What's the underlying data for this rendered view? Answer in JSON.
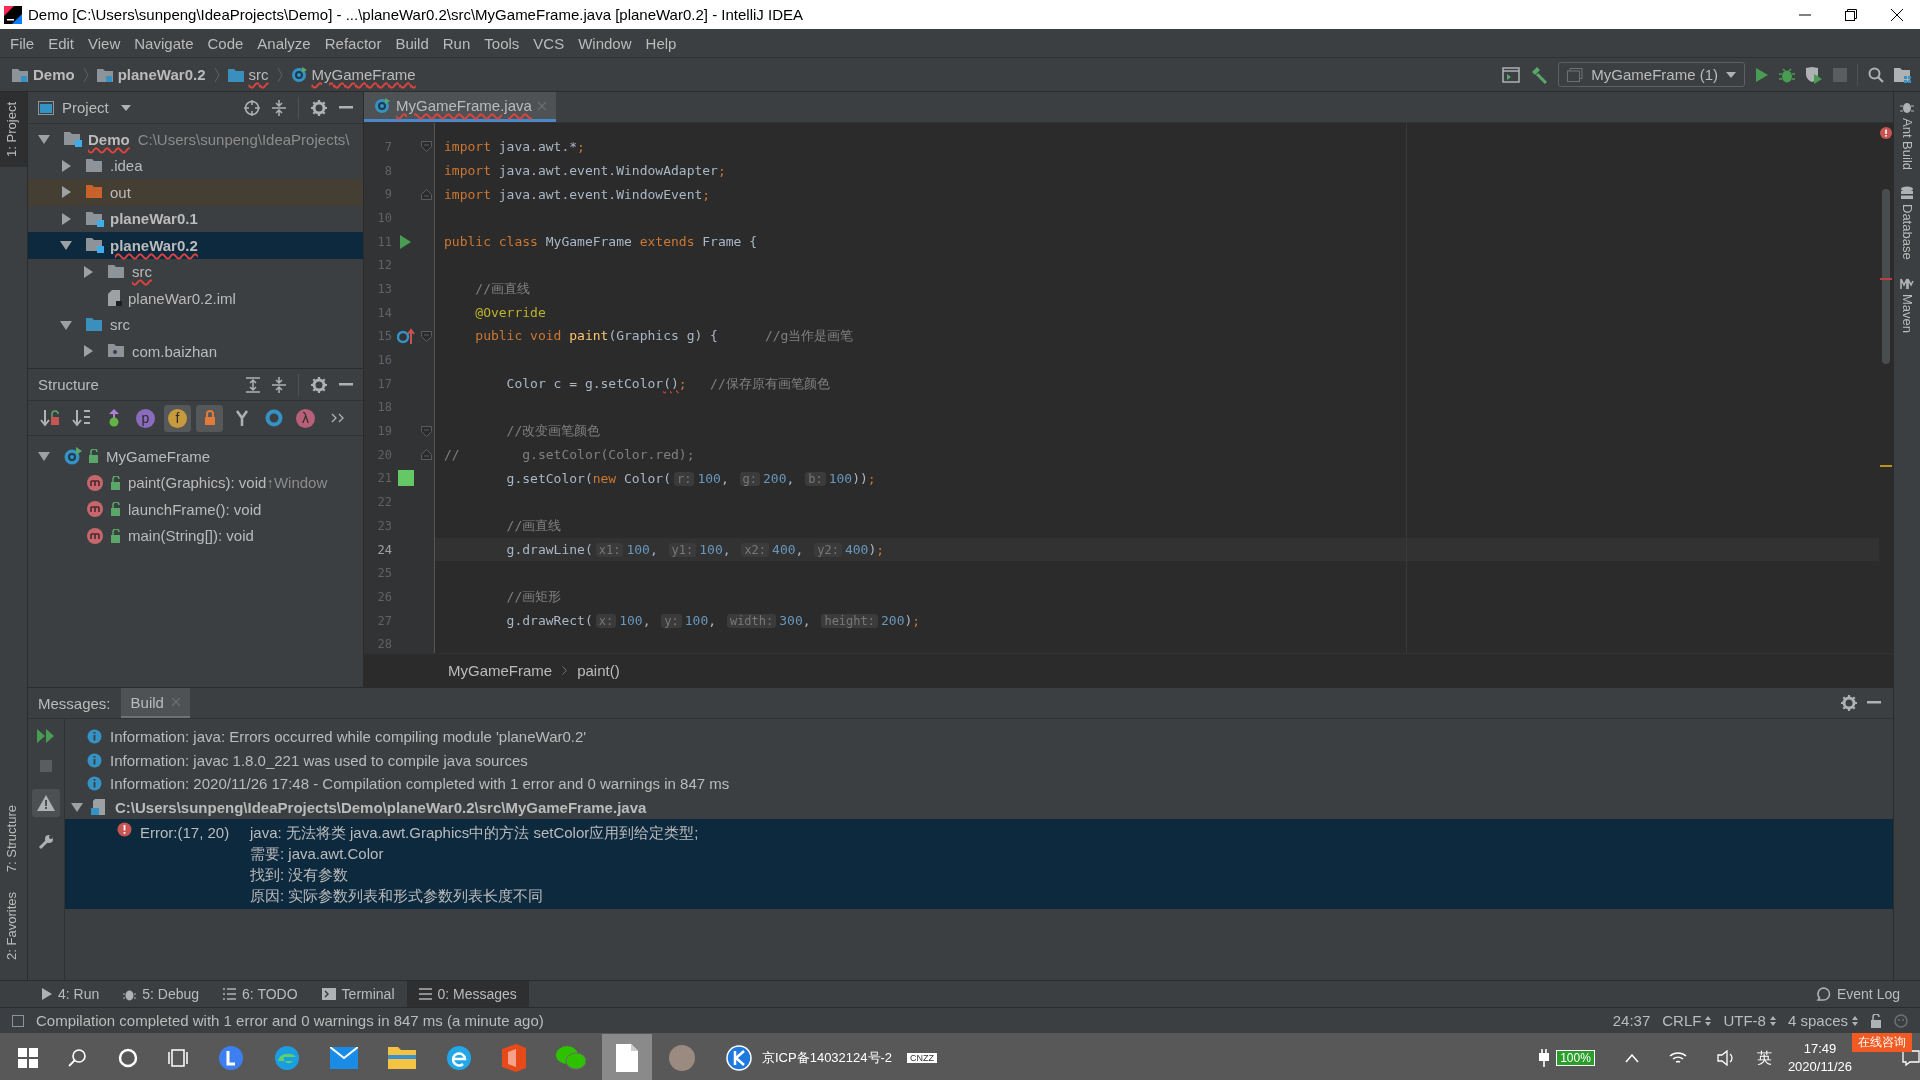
{
  "window": {
    "title": "Demo [C:\\Users\\sunpeng\\IdeaProjects\\Demo] - ...\\planeWar0.2\\src\\MyGameFrame.java [planeWar0.2] - IntelliJ IDEA"
  },
  "menu": [
    "File",
    "Edit",
    "View",
    "Navigate",
    "Code",
    "Analyze",
    "Refactor",
    "Build",
    "Run",
    "Tools",
    "VCS",
    "Window",
    "Help"
  ],
  "breadcrumb": [
    {
      "label": "Demo",
      "kind": "module",
      "error": false
    },
    {
      "label": "planeWar0.2",
      "kind": "module",
      "error": false
    },
    {
      "label": "src",
      "kind": "folder",
      "error": true
    },
    {
      "label": "MyGameFrame",
      "kind": "class",
      "error": true
    }
  ],
  "run_config": {
    "label": "MyGameFrame (1)"
  },
  "left_stripe": [
    {
      "label": "1: Project",
      "selected": true
    },
    {
      "label": "7: Structure",
      "selected": false
    },
    {
      "label": "2: Favorites",
      "selected": false
    }
  ],
  "right_stripe": [
    "Ant Build",
    "Database",
    "Maven"
  ],
  "project": {
    "title": "Project",
    "tree": [
      {
        "label": "Demo",
        "path": "C:\\Users\\sunpeng\\IdeaProjects\\",
        "kind": "module",
        "bold": true,
        "error": true,
        "expanded": true,
        "selected": false,
        "children": [
          {
            "label": ".idea",
            "kind": "folder",
            "bold": false,
            "error": false,
            "expanded": false,
            "selected": false
          },
          {
            "label": "out",
            "kind": "excluded",
            "bold": false,
            "error": false,
            "expanded": false,
            "selected": false
          },
          {
            "label": "planeWar0.1",
            "kind": "module",
            "bold": true,
            "error": false,
            "expanded": false,
            "selected": false
          },
          {
            "label": "planeWar0.2",
            "kind": "module",
            "bold": true,
            "error": true,
            "expanded": true,
            "selected": true,
            "children": [
              {
                "label": "src",
                "kind": "folder",
                "bold": false,
                "error": true,
                "expanded": false,
                "selected": false
              },
              {
                "label": "planeWar0.2.iml",
                "kind": "file",
                "bold": false,
                "error": false,
                "selected": false
              }
            ]
          },
          {
            "label": "src",
            "kind": "source",
            "bold": false,
            "error": false,
            "expanded": true,
            "selected": false,
            "children": [
              {
                "label": "com.baizhan",
                "kind": "package",
                "bold": false,
                "error": false,
                "expanded": false,
                "selected": false
              }
            ]
          }
        ]
      }
    ]
  },
  "structure": {
    "title": "Structure",
    "toolbar": [
      {
        "kind": "sort-visibility",
        "on": false
      },
      {
        "kind": "sort-alpha",
        "on": false
      },
      {
        "kind": "inherited",
        "on": false
      },
      {
        "kind": "badge",
        "glyph": "p",
        "color": "#8b6bbd",
        "on": false
      },
      {
        "kind": "badge",
        "glyph": "f",
        "color": "#c79a3c",
        "on": true
      },
      {
        "kind": "lock",
        "on": true
      },
      {
        "kind": "branch",
        "on": false
      },
      {
        "kind": "ring",
        "on": false
      },
      {
        "kind": "badge",
        "glyph": "λ",
        "color": "#b8607a",
        "on": false
      },
      {
        "kind": "more",
        "on": false
      }
    ],
    "tree": [
      {
        "label": "MyGameFrame",
        "kind": "class",
        "expanded": true,
        "selected": false,
        "children": [
          {
            "label": "paint(Graphics): void",
            "inherited": "↑Window",
            "kind": "method",
            "selected": false
          },
          {
            "label": "launchFrame(): void",
            "kind": "method",
            "selected": false
          },
          {
            "label": "main(String[]): void",
            "kind": "method",
            "selected": false
          }
        ]
      }
    ]
  },
  "editor": {
    "tabs": [
      {
        "label": "MyGameFrame.java",
        "selected": true,
        "error": true
      }
    ],
    "lines": [
      {
        "number": "7",
        "current": false,
        "fold": {
          "kind": "start"
        },
        "tokens": [
          {
            "kind": "kw",
            "text": "import"
          },
          {
            "kind": "plain",
            "text": " java.awt.*"
          },
          {
            "kind": "kw",
            "text": ";"
          }
        ]
      },
      {
        "number": "8",
        "current": false,
        "tokens": [
          {
            "kind": "kw",
            "text": "import"
          },
          {
            "kind": "plain",
            "text": " java.awt.event.WindowAdapter"
          },
          {
            "kind": "kw",
            "text": ";"
          }
        ]
      },
      {
        "number": "9",
        "current": false,
        "fold": {
          "kind": "end"
        },
        "tokens": [
          {
            "kind": "kw",
            "text": "import"
          },
          {
            "kind": "plain",
            "text": " java.awt.event.WindowEvent"
          },
          {
            "kind": "kw",
            "text": ";"
          }
        ]
      },
      {
        "number": "10",
        "current": false
      },
      {
        "number": "11",
        "current": false,
        "marker": {
          "kind": "run"
        },
        "tokens": [
          {
            "kind": "kw",
            "text": "public class "
          },
          {
            "kind": "plain",
            "text": "MyGameFrame "
          },
          {
            "kind": "kw",
            "text": "extends "
          },
          {
            "kind": "plain",
            "text": "Frame {"
          }
        ]
      },
      {
        "number": "12",
        "current": false
      },
      {
        "number": "13",
        "current": false,
        "tokens": [
          {
            "kind": "comment",
            "text": "    //画直线"
          }
        ]
      },
      {
        "number": "14",
        "current": false,
        "tokens": [
          {
            "kind": "ann",
            "text": "    @Override"
          }
        ]
      },
      {
        "number": "15",
        "current": false,
        "marker": {
          "kind": "override"
        },
        "fold": {
          "kind": "start"
        },
        "tokens": [
          {
            "kind": "kw",
            "text": "    public void "
          },
          {
            "kind": "fn",
            "text": "paint"
          },
          {
            "kind": "plain",
            "text": "(Graphics g) {      "
          },
          {
            "kind": "comment",
            "text": "//g当作是画笔"
          }
        ]
      },
      {
        "number": "16",
        "current": false
      },
      {
        "number": "17",
        "current": false,
        "tokens": [
          {
            "kind": "plain",
            "text": "        Color c = g.setColor"
          },
          {
            "kind": "err",
            "text": "()"
          },
          {
            "kind": "kw",
            "text": ";"
          },
          {
            "kind": "comment",
            "text": "   //保存原有画笔颜色"
          }
        ]
      },
      {
        "number": "18",
        "current": false
      },
      {
        "number": "19",
        "current": false,
        "fold": {
          "kind": "start"
        },
        "tokens": [
          {
            "kind": "comment",
            "text": "        //改变画笔颜色"
          }
        ]
      },
      {
        "number": "20",
        "current": false,
        "fold": {
          "kind": "end"
        },
        "tokens": [
          {
            "kind": "comment",
            "text": "//        g.setColor(Color.red);"
          }
        ]
      },
      {
        "number": "21",
        "current": false,
        "marker": {
          "kind": "swatch",
          "color": "#64c864"
        },
        "tokens": [
          {
            "kind": "plain",
            "text": "        g.setColor("
          },
          {
            "kind": "kw",
            "text": "new "
          },
          {
            "kind": "plain",
            "text": "Color("
          },
          {
            "kind": "hint",
            "text": "r:"
          },
          {
            "kind": "num",
            "text": "100"
          },
          {
            "kind": "plain",
            "text": ", "
          },
          {
            "kind": "hint",
            "text": "g:"
          },
          {
            "kind": "num",
            "text": "200"
          },
          {
            "kind": "plain",
            "text": ", "
          },
          {
            "kind": "hint",
            "text": "b:"
          },
          {
            "kind": "num",
            "text": "100"
          },
          {
            "kind": "plain",
            "text": "))"
          },
          {
            "kind": "kw",
            "text": ";"
          }
        ]
      },
      {
        "number": "22",
        "current": false
      },
      {
        "number": "23",
        "current": false,
        "tokens": [
          {
            "kind": "comment",
            "text": "        //画直线"
          }
        ]
      },
      {
        "number": "24",
        "current": true,
        "tokens": [
          {
            "kind": "plain",
            "text": "        g.drawLine("
          },
          {
            "kind": "hint",
            "text": "x1:"
          },
          {
            "kind": "num",
            "text": "100"
          },
          {
            "kind": "plain",
            "text": ", "
          },
          {
            "kind": "hint",
            "text": "y1:"
          },
          {
            "kind": "num",
            "text": "100"
          },
          {
            "kind": "plain",
            "text": ", "
          },
          {
            "kind": "hint",
            "text": "x2:"
          },
          {
            "kind": "num",
            "text": "400"
          },
          {
            "kind": "plain",
            "text": ", "
          },
          {
            "kind": "hint",
            "text": "y2:"
          },
          {
            "kind": "num",
            "text": "400"
          },
          {
            "kind": "plain",
            "text": ")"
          },
          {
            "kind": "kw",
            "text": ";"
          }
        ]
      },
      {
        "number": "25",
        "current": false
      },
      {
        "number": "26",
        "current": false,
        "tokens": [
          {
            "kind": "comment",
            "text": "        //画矩形"
          }
        ]
      },
      {
        "number": "27",
        "current": false,
        "tokens": [
          {
            "kind": "plain",
            "text": "        g.drawRect("
          },
          {
            "kind": "hint",
            "text": "x:"
          },
          {
            "kind": "num",
            "text": "100"
          },
          {
            "kind": "plain",
            "text": ", "
          },
          {
            "kind": "hint",
            "text": "y:"
          },
          {
            "kind": "num",
            "text": "100"
          },
          {
            "kind": "plain",
            "text": ", "
          },
          {
            "kind": "hint",
            "text": "width:"
          },
          {
            "kind": "num",
            "text": "300"
          },
          {
            "kind": "plain",
            "text": ", "
          },
          {
            "kind": "hint",
            "text": "height:"
          },
          {
            "kind": "num",
            "text": "200"
          },
          {
            "kind": "plain",
            "text": ")"
          },
          {
            "kind": "kw",
            "text": ";"
          }
        ]
      },
      {
        "number": "28",
        "current": false
      }
    ],
    "breadcrumb": [
      "MyGameFrame",
      "paint()"
    ]
  },
  "messages": {
    "title": "Messages:",
    "tabs": [
      {
        "label": "Build",
        "selected": true
      }
    ],
    "rows": [
      {
        "kind": "info",
        "text": "Information: java: Errors occurred while compiling module 'planeWar0.2'",
        "selected": false
      },
      {
        "kind": "info",
        "text": "Information: javac 1.8.0_221 was used to compile java sources",
        "selected": false
      },
      {
        "kind": "info",
        "text": "Information: 2020/11/26 17:48 - Compilation completed with 1 error and 0 warnings in 847 ms",
        "selected": false
      },
      {
        "kind": "file",
        "text": "C:\\Users\\sunpeng\\IdeaProjects\\Demo\\planeWar0.2\\src\\MyGameFrame.java",
        "expanded": true,
        "selected": false,
        "children": [
          {
            "kind": "error",
            "location": "Error:(17, 20)",
            "text": "java: 无法将类 java.awt.Graphics中的方法 setColor应用到给定类型;",
            "details": [
              "需要: java.awt.Color",
              "找到: 没有参数",
              "原因: 实际参数列表和形式参数列表长度不同"
            ],
            "selected": true
          }
        ]
      }
    ]
  },
  "tool_tabs": [
    {
      "label": "4: Run",
      "kind": "run",
      "selected": false
    },
    {
      "label": "5: Debug",
      "kind": "debug",
      "selected": false
    },
    {
      "label": "6: TODO",
      "kind": "todo",
      "selected": false
    },
    {
      "label": "Terminal",
      "kind": "terminal",
      "selected": false
    },
    {
      "label": "0: Messages",
      "kind": "messages",
      "selected": true
    }
  ],
  "event_log": "Event Log",
  "status": {
    "text": "Compilation completed with 1 error and 0 warnings in 847 ms (a minute ago)",
    "position": "24:37",
    "line_separator": "CRLF",
    "encoding": "UTF-8",
    "indent": "4 spaces"
  },
  "taskbar": {
    "icp": "京ICP备14032124号-2",
    "cnzz": "CNZZ",
    "battery": "100%",
    "ime": "英",
    "time": "17:49",
    "date": "2020/11/26",
    "consult": "在线咨询"
  }
}
